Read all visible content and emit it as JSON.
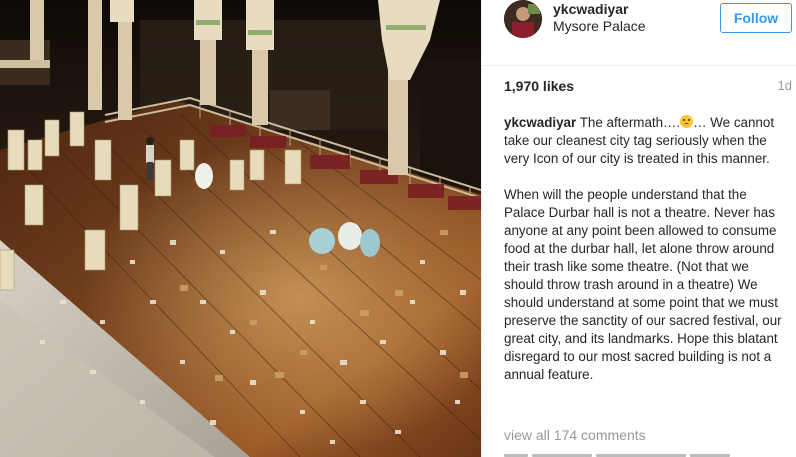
{
  "post": {
    "username": "ykcwadiyar",
    "location": "Mysore Palace",
    "follow_label": "Follow",
    "likes": "1,970 likes",
    "time_ago": "1d",
    "caption": {
      "username": "ykcwadiyar",
      "line1_before_emoji": " The aftermath….",
      "emoji_icon": "slightly-smiling-face-icon",
      "line1_after_emoji": "… We cannot take our cleanest city tag seriously when the very Icon of our city is treated in this manner.",
      "paragraph2": "When will the people understand that the Palace Durbar hall is not a theatre. Never has anyone at any point been allowed to consume food at the durbar hall, let alone throw around their trash like some theatre. (Not that we should throw trash around in a theatre) We should understand at some point that we must preserve the sanctity of our sacred festival, our great city, and its landmarks. Hope this blatant disregard to our most sacred building is not a annual feature."
    },
    "view_comments": "view all 174 comments",
    "colors": {
      "follow_blue": "#3897f0",
      "muted_text": "#999999",
      "text": "#262626",
      "floor_wood": "#6b3a1c",
      "pillar_cream": "#d9c9a8"
    }
  }
}
